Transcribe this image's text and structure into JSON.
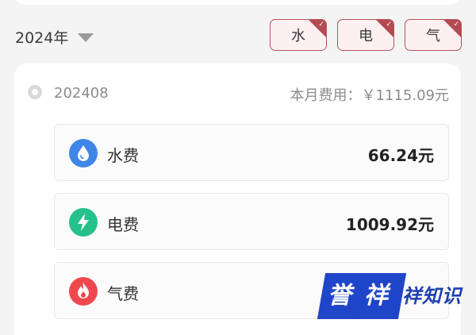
{
  "year": {
    "label": "2024年"
  },
  "filters": [
    {
      "label": "水",
      "selected": true
    },
    {
      "label": "电",
      "selected": true
    },
    {
      "label": "气",
      "selected": true
    }
  ],
  "month": {
    "period": "202408",
    "total_label": "本月费用：￥1115.09元"
  },
  "fees": [
    {
      "name": "水费",
      "value": "66.24元",
      "icon": "water-drop-icon",
      "icon_color": "#3f86e8"
    },
    {
      "name": "电费",
      "value": "1009.92元",
      "icon": "lightning-bolt-icon",
      "icon_color": "#26c08a"
    },
    {
      "name": "气费",
      "value": "",
      "icon": "flame-icon",
      "icon_color": "#f0484f"
    }
  ],
  "watermark": {
    "part1": "誉",
    "part2": "祥",
    "part3": "祥知识"
  },
  "colors": {
    "accent_red": "#b54a52",
    "filter_bg": "#fdf0f1",
    "watermark_blue": "#1f45c8"
  }
}
